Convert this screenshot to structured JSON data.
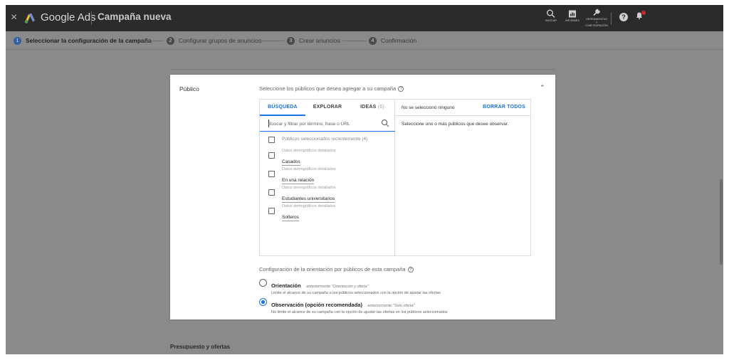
{
  "topbar": {
    "close_glyph": "×",
    "brand": "Google Ads",
    "campaign": "Campaña nueva",
    "buttons": [
      {
        "icon": "search-icon",
        "label": "BUSCAR"
      },
      {
        "icon": "reports-icon",
        "label": "INFORMES"
      },
      {
        "icon": "wrench-icon",
        "label_lines": [
          "HERRAMIENTAS",
          "Y",
          "CONFIGURACIÓN"
        ]
      }
    ],
    "help_glyph": "?",
    "bell_glyph": "🔔"
  },
  "steps": [
    {
      "num": "1",
      "label": "Seleccionar la configuración de la campaña",
      "active": true
    },
    {
      "num": "2",
      "label": "Configurar grupos de anuncios",
      "active": false
    },
    {
      "num": "3",
      "label": "Crear anuncios",
      "active": false
    },
    {
      "num": "4",
      "label": "Confirmación",
      "active": false
    }
  ],
  "audience": {
    "title": "Público",
    "description": "Seleccione los públicos que desea agregar a su campaña",
    "help_glyph": "?",
    "collapse_glyph": "⌃",
    "tabs": [
      {
        "label": "BÚSQUEDA",
        "count": "",
        "active": true
      },
      {
        "label": "EXPLORAR",
        "count": "",
        "active": false
      },
      {
        "label": "IDEAS",
        "count": "(6)",
        "active": false
      }
    ],
    "search_placeholder": "Buscar y filtrar por término, frase o URL",
    "recent_label": "Públicos seleccionados recientemente (4)",
    "items": [
      {
        "category": "Datos demográficos detallados",
        "value": "Casados"
      },
      {
        "category": "Datos demográficos detallados",
        "value": "En una relación"
      },
      {
        "category": "Datos demográficos detallados",
        "value": "Estudiantes universitarios"
      },
      {
        "category": "Datos demográficos detallados",
        "value": "Solteros"
      }
    ],
    "none_selected": "No se seleccionó ninguno",
    "clear_all": "BORRAR TODOS",
    "right_hint": "Seleccione uno o más públicos que desee observar.",
    "orientation_title": "Configuración de la orientación por públicos de esta campaña",
    "options": [
      {
        "label": "Orientación",
        "previously": "anteriormente \"Orientación y oferta\"",
        "desc": "Limite el alcance de su campaña a los públicos seleccionados con la opción de ajustar las ofertas",
        "selected": false
      },
      {
        "label": "Observación (opción recomendada)",
        "previously": "anteriormente \"Solo oferta\"",
        "desc": "No limite el alcance de su campaña con la opción de ajustar las ofertas en los públicos seleccionados",
        "selected": true
      }
    ]
  },
  "next_section": "Presupuesto y ofertas",
  "colors": {
    "accent": "#1a73e8",
    "topbar": "#2b2b2b",
    "overlay": "#8a8a8a",
    "step_active": "#2e5fa8"
  }
}
